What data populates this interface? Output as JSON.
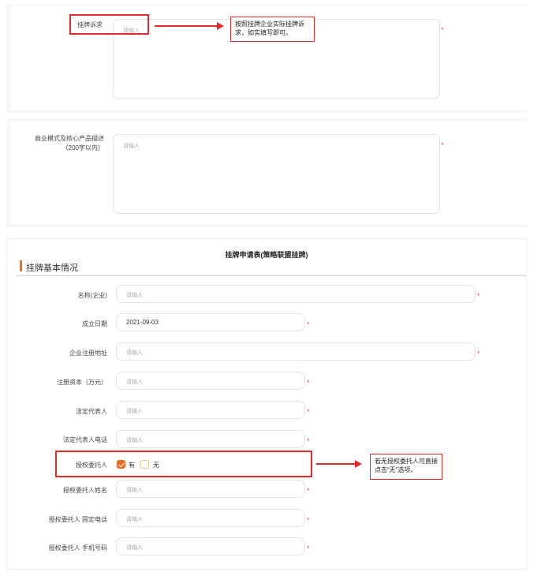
{
  "top_form": {
    "listing_appeal": {
      "label": "挂牌诉求",
      "placeholder": "请输入"
    },
    "business_model": {
      "label_line1": "商业模式及核心产品描述",
      "label_line2": "（200字以内）",
      "placeholder": "请输入"
    },
    "annotation": "按照挂牌企业实际挂牌诉求，如实填写即可。"
  },
  "form": {
    "title": "挂牌申请表(策略联盟挂牌)",
    "section_title": "挂牌基本情况",
    "fields": [
      {
        "label": "名称(企业)",
        "placeholder": "请输入",
        "value": ""
      },
      {
        "label": "成立日期",
        "placeholder": "",
        "value": "2021-09-03"
      },
      {
        "label": "企业注册地址",
        "placeholder": "请输入",
        "value": ""
      },
      {
        "label": "注册资本（万元）",
        "placeholder": "请输入",
        "value": ""
      },
      {
        "label": "法定代表人",
        "placeholder": "请输入",
        "value": ""
      },
      {
        "label": "法定代表人电话",
        "placeholder": "请输入",
        "value": ""
      },
      {
        "label": "授权委托人姓名",
        "placeholder": "请输入",
        "value": ""
      },
      {
        "label": "授权委托人 固定电话",
        "placeholder": "请输入",
        "value": ""
      },
      {
        "label": "授权委托人 手机号码",
        "placeholder": "请输入",
        "value": ""
      }
    ],
    "authorized_agent": {
      "label": "授权委托人",
      "option_yes": "有",
      "option_no": "无",
      "selected": "有"
    },
    "annotation": "若无授权委托人可直接点击“无”选项。",
    "required_mark": "*"
  },
  "colors": {
    "accent": "#e86d1f",
    "annotation_red": "#e32b2b",
    "required": "#e64a3b"
  }
}
